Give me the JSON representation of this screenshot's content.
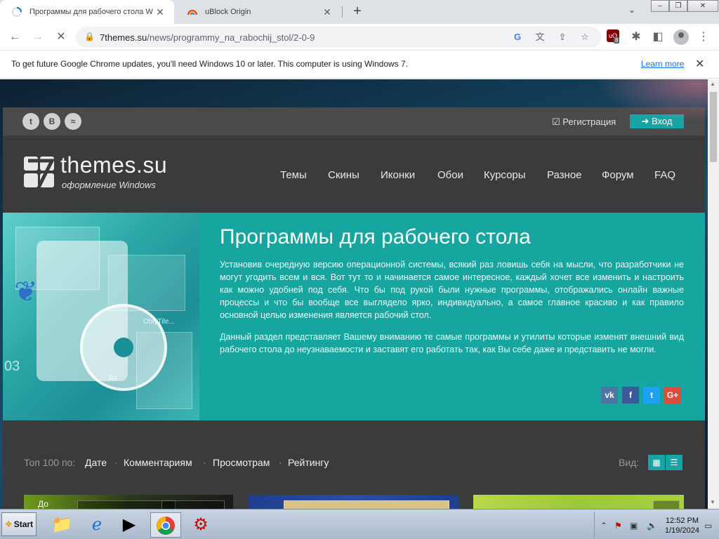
{
  "browser": {
    "tabs": [
      {
        "title": "Программы для рабочего стола W"
      },
      {
        "title": "uBlock Origin"
      }
    ],
    "new_tab_symbol": "+",
    "tab_search_symbol": "⌄",
    "window_controls": {
      "minimize": "–",
      "maximize": "❐",
      "close": "✕"
    },
    "url_domain": "7themes.su",
    "url_path": "/news/programmy_na_rabochij_stol/2-0-9",
    "extension_count": "8",
    "extension_badge": "uO"
  },
  "infobar": {
    "message": "To get future Google Chrome updates, you'll need Windows 10 or later. This computer is using Windows 7.",
    "link": "Learn more"
  },
  "site": {
    "social_top": [
      "t",
      "B",
      "≈"
    ],
    "register": "☑ Регистрация",
    "login": "➜ Вход",
    "logo_text": "themes.su",
    "logo_sub": "оформление Windows",
    "nav": [
      "Темы",
      "Скины",
      "Иконки",
      "Обои",
      "Курсоры",
      "Разное",
      "Форум",
      "FAQ"
    ],
    "hero": {
      "title": "Программы для рабочего стола",
      "p1": "Установив очередную версию операционной системы, всякий раз ловишь себя на мысли, что разработчики не могут угодить всем и вся. Вот тут то и начинается самое интересное, каждый хочет все изменить и настроить как можно удобней под себя. Что бы под рукой были нужные программы, отображались онлайн важные процессы и что бы вообще все выглядело ярко, индивидуально, а самое главное красиво и как правило основной целью изменения является рабочий стол.",
      "p2": "Данный раздел представляет Вашему вниманию те самые программы и утилиты которые изменят внешний вид рабочего стола до неузнаваемости и заставят его работать так, как Вы себе даже и представить не могли.",
      "image_texts": {
        "num": "03",
        "tile": "OblyTile...",
        "da": "Да"
      },
      "share": [
        {
          "label": "vk",
          "color": "#4c75a3"
        },
        {
          "label": "f",
          "color": "#3b5998"
        },
        {
          "label": "t",
          "color": "#1da1f2"
        },
        {
          "label": "G+",
          "color": "#dd4b39"
        }
      ]
    },
    "sort": {
      "label": "Топ 100 по:",
      "items": [
        "Дате",
        "Комментариям",
        "Просмотрам",
        "Рейтингу"
      ],
      "separator": "·",
      "view_label": "Вид:",
      "view_grid": "▦",
      "view_list": "☰"
    },
    "thumb_captions": {
      "t1": "До"
    }
  },
  "taskbar": {
    "start_label": "Start",
    "time": "12:52 PM",
    "date": "1/19/2024"
  },
  "colors": {
    "accent": "#18a4a4",
    "hero_bg": "#17a5a0",
    "site_bg": "#3b3b3b"
  }
}
